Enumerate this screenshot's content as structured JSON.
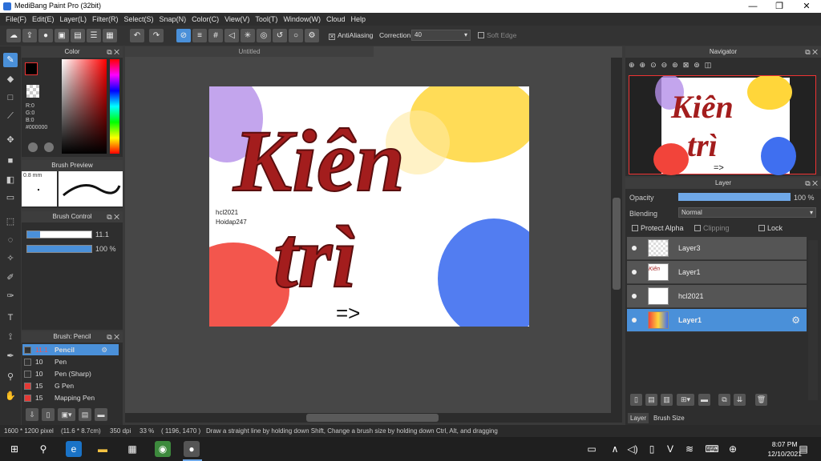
{
  "window": {
    "title": "MediBang Paint Pro (32bit)",
    "min": "—",
    "max": "❐",
    "close": "✕"
  },
  "menu": [
    "File(F)",
    "Edit(E)",
    "Layer(L)",
    "Filter(R)",
    "Select(S)",
    "Snap(N)",
    "Color(C)",
    "View(V)",
    "Tool(T)",
    "Window(W)",
    "Cloud",
    "Help"
  ],
  "toolbar": {
    "antialiasing": "AntiAliasing",
    "correction_label": "Correction",
    "correction_value": "40",
    "soft_edge": "Soft Edge"
  },
  "color_panel": {
    "title": "Color",
    "r": "R:0",
    "g": "G:0",
    "b": "B:0",
    "hex": "#000000"
  },
  "brush_preview": {
    "title": "Brush Preview",
    "size": "0.8 mm"
  },
  "brush_control": {
    "title": "Brush Control",
    "size": "11.1",
    "opacity": "100 %"
  },
  "brush_panel": {
    "title": "Brush: Pencil",
    "items": [
      {
        "size": "11.1",
        "name": "Pencil",
        "color": "#333333",
        "active": true
      },
      {
        "size": "10",
        "name": "Pen",
        "color": "#333333"
      },
      {
        "size": "10",
        "name": "Pen (Sharp)",
        "color": "#333333"
      },
      {
        "size": "15",
        "name": "G Pen",
        "color": "#e53935"
      },
      {
        "size": "15",
        "name": "Mapping Pen",
        "color": "#e53935"
      }
    ]
  },
  "document": {
    "tab": "Untitled",
    "main_text": "Kiên trì",
    "sub_text_1": "hcl2021",
    "sub_text_2": "Hoidap247",
    "arrow": "=>"
  },
  "navigator": {
    "title": "Navigator"
  },
  "layer_panel": {
    "title": "Layer",
    "opacity_label": "Opacity",
    "opacity_value": "100 %",
    "opacity_fraction": 1.0,
    "blending_label": "Blending",
    "blending_value": "Normal",
    "protect_alpha": "Protect Alpha",
    "clipping": "Clipping",
    "lock": "Lock",
    "layers": [
      {
        "name": "Layer3",
        "active": false
      },
      {
        "name": "Layer1",
        "active": false
      },
      {
        "name": "hcl2021",
        "active": false
      },
      {
        "name": "Layer1",
        "active": true
      }
    ]
  },
  "bottom_tabs": [
    "Layer",
    "Brush Size"
  ],
  "status": {
    "size": "1600 * 1200 pixel",
    "cm": "(11.6 * 8.7cm)",
    "dpi": "350 dpi",
    "zoom": "33 %",
    "coords": "( 1196, 1470 )",
    "hint": "Draw a straight line by holding down Shift, Change a brush size by holding down Ctrl, Alt, and dragging"
  },
  "clock": {
    "time": "8:07 PM",
    "date": "12/10/2021"
  }
}
